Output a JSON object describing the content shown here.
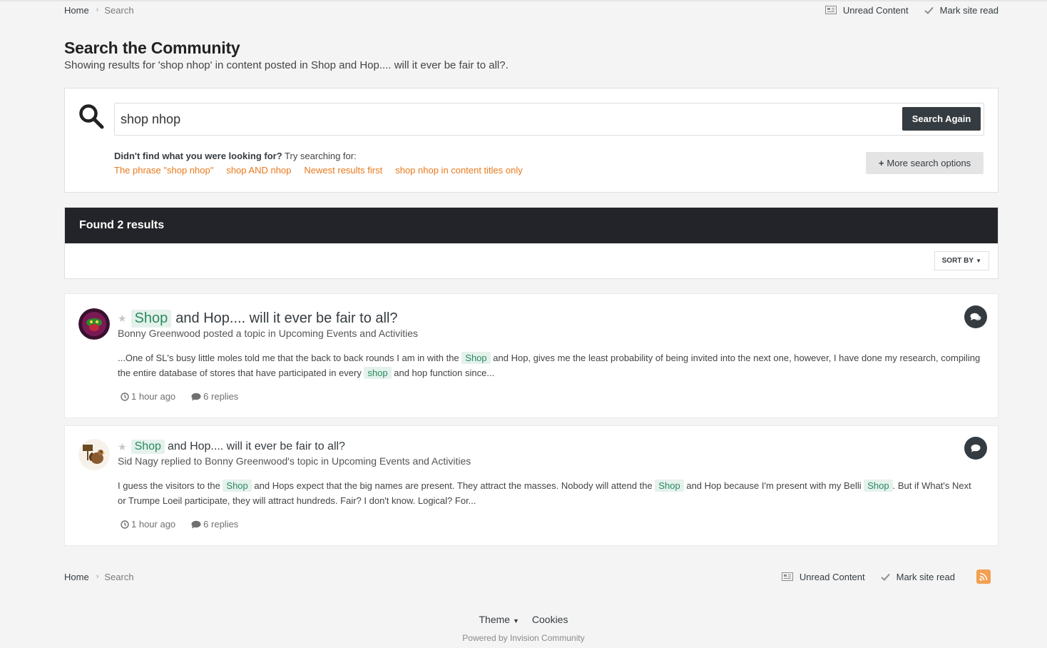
{
  "breadcrumb": {
    "home": "Home",
    "current": "Search"
  },
  "header_actions": {
    "unread": "Unread Content",
    "mark_read": "Mark site read"
  },
  "page": {
    "title": "Search the Community",
    "description": "Showing results for 'shop nhop' in content posted in Shop and Hop.... will it ever be fair to all?."
  },
  "search": {
    "query": "shop nhop",
    "button": "Search Again",
    "hint_bold": "Didn't find what you were looking for?",
    "hint_rest": "Try searching for:",
    "suggestions": [
      "The phrase \"shop nhop\"",
      "shop AND nhop",
      "Newest results first",
      "shop nhop in content titles only"
    ],
    "more_options": "More search options"
  },
  "results_header": {
    "title": "Found 2 results",
    "sort": "SORT BY"
  },
  "results": [
    {
      "title_hl": "Shop",
      "title_rest": "and Hop.... will it ever be fair to all?",
      "meta": "Bonny Greenwood posted a topic in Upcoming Events and Activities",
      "snippet": [
        {
          "t": "...One of SL's busy little moles told me that the back to back rounds I am in with the "
        },
        {
          "h": "Shop"
        },
        {
          "t": " and Hop, gives me the least probability of being invited into the next one, however, I have done my research, compiling the entire database of stores that have participated in every "
        },
        {
          "h": "shop"
        },
        {
          "t": " and hop function since..."
        }
      ],
      "time": "1 hour ago",
      "replies": "6 replies",
      "type_icon": "comments-icon"
    },
    {
      "title_hl": "Shop",
      "title_rest": "and Hop.... will it ever be fair to all?",
      "meta": "Sid Nagy replied to Bonny Greenwood's topic in Upcoming Events and Activities",
      "snippet": [
        {
          "t": "I guess the visitors to the "
        },
        {
          "h": "Shop"
        },
        {
          "t": " and Hops expect that the big names are present. They attract the masses. Nobody will attend the "
        },
        {
          "h": "Shop"
        },
        {
          "t": " and Hop because I'm present with my Belli "
        },
        {
          "h": "Shop"
        },
        {
          "t": ". But if What's Next or Trumpe Loeil participate, they will attract hundreds. Fair? I don't know. Logical? For..."
        }
      ],
      "time": "1 hour ago",
      "replies": "6 replies",
      "type_icon": "comment-icon"
    }
  ],
  "footer": {
    "theme": "Theme",
    "cookies": "Cookies",
    "powered": "Powered by Invision Community"
  },
  "colors": {
    "accent_link": "#e8791c",
    "dark": "#353c41",
    "results_bar": "#222429",
    "highlight_bg": "#e4f1ec",
    "highlight_text": "#2b8a5f"
  }
}
